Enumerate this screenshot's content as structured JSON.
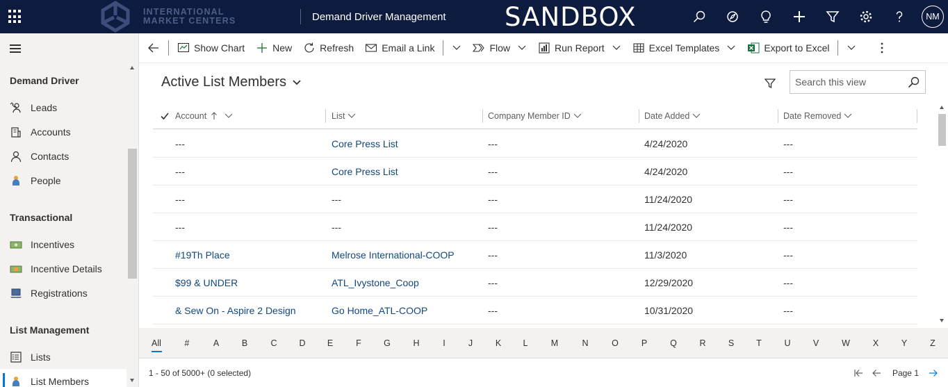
{
  "topbar": {
    "logo_line1": "INTERNATIONAL",
    "logo_line2": "MARKET CENTERS",
    "app_title": "Demand Driver Management",
    "environment_banner": "SANDBOX",
    "user_initials": "NM",
    "icons": [
      "waffle-icon",
      "search-icon",
      "assistant-icon",
      "lightbulb-icon",
      "plus-icon",
      "filter-icon",
      "gear-icon",
      "help-icon"
    ]
  },
  "sidebar": {
    "groups": [
      {
        "title": "Demand Driver",
        "items": [
          {
            "label": "Leads",
            "icon": "phone-person-icon"
          },
          {
            "label": "Accounts",
            "icon": "building-icon"
          },
          {
            "label": "Contacts",
            "icon": "person-icon"
          },
          {
            "label": "People",
            "icon": "people-icon"
          }
        ]
      },
      {
        "title": "Transactional",
        "items": [
          {
            "label": "Incentives",
            "icon": "money-icon"
          },
          {
            "label": "Incentive Details",
            "icon": "money-detail-icon"
          },
          {
            "label": "Registrations",
            "icon": "laptop-icon"
          }
        ]
      },
      {
        "title": "List Management",
        "items": [
          {
            "label": "Lists",
            "icon": "list-icon"
          },
          {
            "label": "List Members",
            "icon": "person-icon",
            "selected": true
          }
        ]
      }
    ]
  },
  "commandbar": {
    "back": "back-arrow-icon",
    "items": [
      {
        "label": "Show Chart",
        "icon": "chart-icon"
      },
      {
        "label": "New",
        "icon": "plus-icon"
      },
      {
        "label": "Refresh",
        "icon": "refresh-icon"
      },
      {
        "label": "Email a Link",
        "icon": "email-icon"
      },
      {
        "label": "Flow",
        "icon": "flow-icon"
      },
      {
        "label": "Run Report",
        "icon": "report-icon"
      },
      {
        "label": "Excel Templates",
        "icon": "excel-template-icon"
      },
      {
        "label": "Export to Excel",
        "icon": "excel-icon"
      }
    ]
  },
  "view": {
    "title": "Active List Members",
    "search_placeholder": "Search this view"
  },
  "grid": {
    "columns": [
      "Account",
      "List",
      "Company Member ID",
      "Date Added",
      "Date Removed"
    ],
    "sort_column": "Account",
    "rows": [
      {
        "account": "---",
        "list": "Core Press List",
        "member_id": "---",
        "date_added": "4/24/2020",
        "date_removed": "---"
      },
      {
        "account": "---",
        "list": "Core Press List",
        "member_id": "---",
        "date_added": "4/24/2020",
        "date_removed": "---"
      },
      {
        "account": "---",
        "list": "---",
        "member_id": "---",
        "date_added": "11/24/2020",
        "date_removed": "---"
      },
      {
        "account": "---",
        "list": "---",
        "member_id": "---",
        "date_added": "11/24/2020",
        "date_removed": "---"
      },
      {
        "account": "#19Th Place",
        "list": "Melrose International-COOP",
        "member_id": "---",
        "date_added": "11/3/2020",
        "date_removed": "---"
      },
      {
        "account": "$99 & UNDER",
        "list": "ATL_Ivystone_Coop",
        "member_id": "---",
        "date_added": "12/29/2020",
        "date_removed": "---"
      },
      {
        "account": "& Sew On - Aspire 2 Design",
        "list": "Go Home_ATL-COOP",
        "member_id": "---",
        "date_added": "10/31/2020",
        "date_removed": "---"
      }
    ]
  },
  "alphabet": [
    "All",
    "#",
    "A",
    "B",
    "C",
    "D",
    "E",
    "F",
    "G",
    "H",
    "I",
    "J",
    "K",
    "L",
    "M",
    "N",
    "O",
    "P",
    "Q",
    "R",
    "S",
    "T",
    "U",
    "V",
    "W",
    "X",
    "Y",
    "Z"
  ],
  "footer": {
    "record_count": "1 - 50 of 5000+ (0 selected)",
    "page_label": "Page 1"
  },
  "colors": {
    "header_bg": "#0d1b3e",
    "link": "#11487f",
    "accent": "#0078d4",
    "excel_green": "#1d6f42"
  }
}
